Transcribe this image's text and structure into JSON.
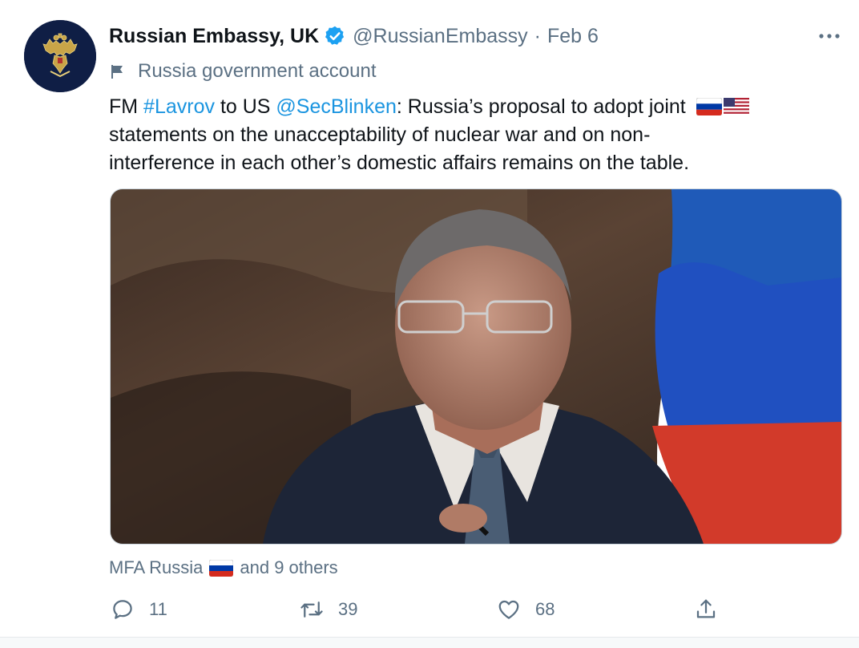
{
  "tweet": {
    "author": {
      "display_name": "Russian Embassy, UK",
      "handle": "@RussianEmbassy",
      "separator": "·",
      "date": "Feb 6",
      "avatar_icon": "double-headed-eagle-emblem",
      "verified_icon": "verified-badge-icon"
    },
    "label": {
      "icon": "flag-icon",
      "text": "Russia government account"
    },
    "text": {
      "l1_a": "FM ",
      "l1_hashtag": "#Lavrov",
      "l1_b": " to US ",
      "l1_mention": "@SecBlinken",
      "l1_c": ": Russia’s proposal to adopt joint",
      "l2": "statements on the unacceptability of nuclear war and on non-",
      "l3": "interference in each other’s domestic affairs remains on the table."
    },
    "media": {
      "alt": "photo"
    },
    "liked_by": {
      "name": "MFA Russia",
      "suffix": "and 9 others"
    },
    "actions": {
      "reply_count": "11",
      "retweet_count": "39",
      "like_count": "68"
    }
  },
  "colors": {
    "link": "#1b95e0",
    "secondary_text": "#5b7083",
    "verified": "#1da1f2"
  }
}
